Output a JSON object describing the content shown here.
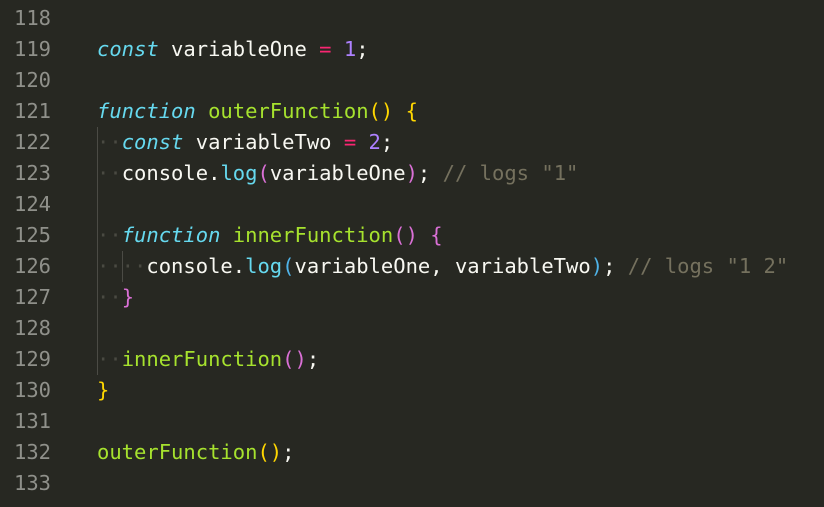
{
  "editor": {
    "language": "javascript",
    "lines": [
      {
        "number": "118",
        "tokens": []
      },
      {
        "number": "119",
        "tokens": [
          {
            "t": "const",
            "c": "kw"
          },
          {
            "t": " variableOne "
          },
          {
            "t": "=",
            "c": "op"
          },
          {
            "t": " "
          },
          {
            "t": "1",
            "c": "num"
          },
          {
            "t": ";"
          }
        ]
      },
      {
        "number": "120",
        "tokens": []
      },
      {
        "number": "121",
        "tokens": [
          {
            "t": "function",
            "c": "kw"
          },
          {
            "t": " "
          },
          {
            "t": "outerFunction",
            "c": "fn"
          },
          {
            "t": "()",
            "c": "b1"
          },
          {
            "t": " "
          },
          {
            "t": "{",
            "c": "b1"
          }
        ]
      },
      {
        "number": "122",
        "tokens": [
          {
            "t": "··",
            "c": "ws"
          },
          {
            "t": "const",
            "c": "kw"
          },
          {
            "t": " variableTwo "
          },
          {
            "t": "=",
            "c": "op"
          },
          {
            "t": " "
          },
          {
            "t": "2",
            "c": "num"
          },
          {
            "t": ";"
          }
        ]
      },
      {
        "number": "123",
        "tokens": [
          {
            "t": "··",
            "c": "ws"
          },
          {
            "t": "console."
          },
          {
            "t": "log",
            "c": "kw-plain"
          },
          {
            "t": "(",
            "c": "b2"
          },
          {
            "t": "variableOne"
          },
          {
            "t": ")",
            "c": "b2"
          },
          {
            "t": "; "
          },
          {
            "t": "// logs \"1\"",
            "c": "cm"
          }
        ]
      },
      {
        "number": "124",
        "tokens": []
      },
      {
        "number": "125",
        "tokens": [
          {
            "t": "··",
            "c": "ws"
          },
          {
            "t": "function",
            "c": "kw"
          },
          {
            "t": " "
          },
          {
            "t": "innerFunction",
            "c": "fn"
          },
          {
            "t": "()",
            "c": "b2"
          },
          {
            "t": " "
          },
          {
            "t": "{",
            "c": "b2"
          }
        ]
      },
      {
        "number": "126",
        "tokens": [
          {
            "t": "····",
            "c": "ws"
          },
          {
            "t": "console."
          },
          {
            "t": "log",
            "c": "kw-plain"
          },
          {
            "t": "(",
            "c": "b3"
          },
          {
            "t": "variableOne, variableTwo"
          },
          {
            "t": ")",
            "c": "b3"
          },
          {
            "t": "; "
          },
          {
            "t": "// logs \"1 2\"",
            "c": "cm"
          }
        ]
      },
      {
        "number": "127",
        "tokens": [
          {
            "t": "··",
            "c": "ws"
          },
          {
            "t": "}",
            "c": "b2"
          }
        ]
      },
      {
        "number": "128",
        "tokens": []
      },
      {
        "number": "129",
        "tokens": [
          {
            "t": "··",
            "c": "ws"
          },
          {
            "t": "innerFunction",
            "c": "fn"
          },
          {
            "t": "()",
            "c": "b2"
          },
          {
            "t": ";"
          }
        ]
      },
      {
        "number": "130",
        "tokens": [
          {
            "t": "}",
            "c": "b1"
          }
        ]
      },
      {
        "number": "131",
        "tokens": []
      },
      {
        "number": "132",
        "tokens": [
          {
            "t": "outerFunction",
            "c": "fn"
          },
          {
            "t": "()",
            "c": "b1"
          },
          {
            "t": ";"
          }
        ]
      },
      {
        "number": "133",
        "tokens": []
      }
    ]
  },
  "theme": {
    "background": "#272822",
    "line_number": "#8f908a",
    "text": "#f8f8f2",
    "keyword": "#66d9ef",
    "function": "#a6e22e",
    "operator": "#f92672",
    "number": "#ae81ff",
    "comment": "#75715e"
  }
}
